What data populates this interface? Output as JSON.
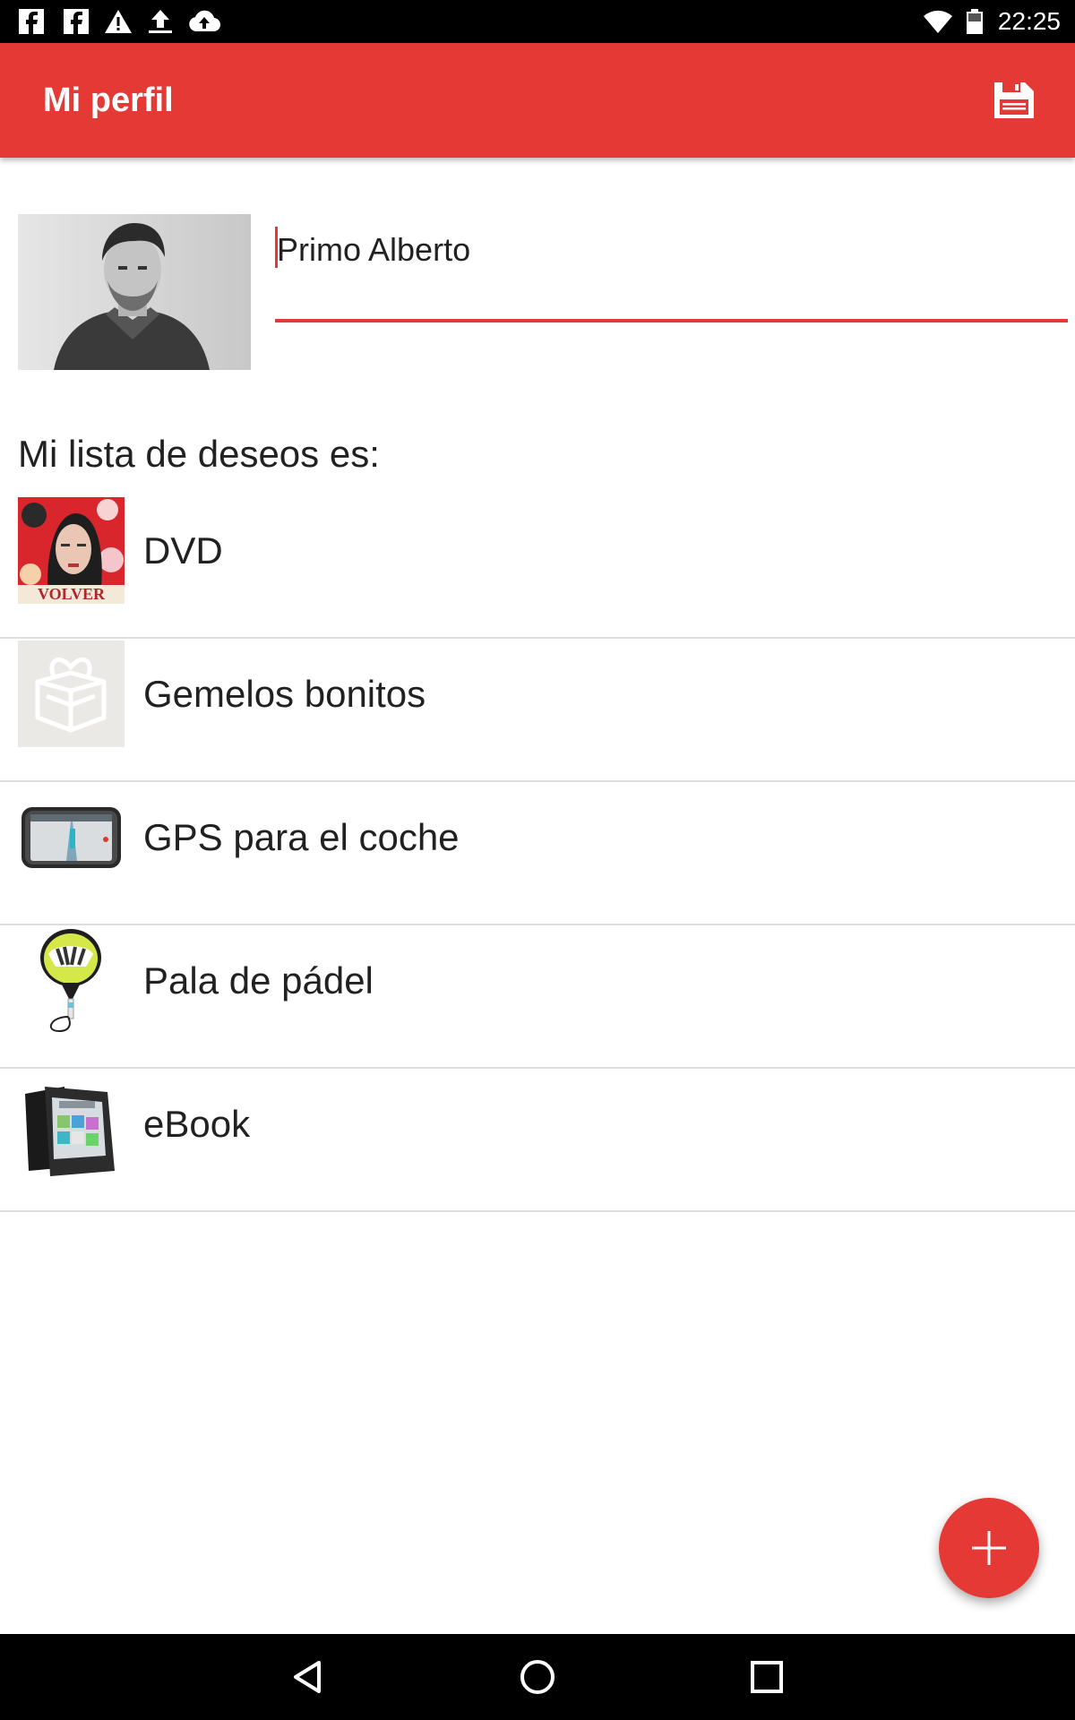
{
  "status_bar": {
    "time": "22:25",
    "left_icons": [
      "facebook-icon",
      "facebook-icon",
      "warning-icon",
      "upload-icon",
      "cloud-upload-icon"
    ],
    "right_icons": [
      "wifi-icon",
      "battery-icon"
    ]
  },
  "app_bar": {
    "title": "Mi perfil",
    "action_icon": "save-icon",
    "background": "#e53935"
  },
  "profile": {
    "name_value": "Primo Alberto",
    "photo": "profile-photo"
  },
  "wishlist": {
    "heading": "Mi lista de deseos es:",
    "items": [
      {
        "label": "DVD",
        "thumbnail": "dvd-cover-image",
        "thumb_text": "VOLVER"
      },
      {
        "label": "Gemelos bonitos",
        "thumbnail": "gift-placeholder-icon"
      },
      {
        "label": "GPS para el coche",
        "thumbnail": "gps-device-image"
      },
      {
        "label": "Pala de pádel",
        "thumbnail": "padel-racket-image"
      },
      {
        "label": "eBook",
        "thumbnail": "ebook-reader-image"
      }
    ]
  },
  "fab": {
    "icon": "plus-icon",
    "color": "#e53935"
  },
  "nav_bar": {
    "buttons": [
      "back-icon",
      "home-icon",
      "recents-icon"
    ]
  }
}
